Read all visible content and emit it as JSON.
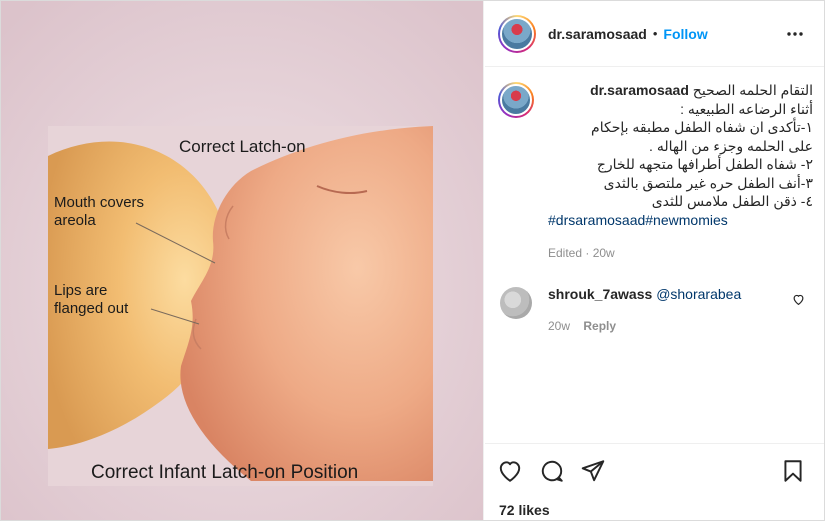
{
  "post": {
    "username": "dr.saramosaad",
    "separator": "•",
    "follow_label": "Follow",
    "more_icon": "more-horizontal-icon"
  },
  "image": {
    "title_top": "Correct Latch-on",
    "label_mouth": "Mouth covers areola",
    "label_lips": "Lips are flanged out",
    "title_bottom": "Correct Infant Latch-on Position",
    "colors": {
      "background": "#e8d7dc",
      "breast": "#f2c07a",
      "face": "#f1b38e"
    }
  },
  "caption": {
    "username": "dr.saramosaad",
    "lines": [
      "التقام الحلمه الصحيح",
      "أثناء الرضاعه الطبيعيه :",
      "١-تأكدى ان شفاه الطفل مطبقه بإحكام",
      "على الحلمه وجزء من الهاله .",
      "٢- شفاه الطفل أطرافها متجهه للخارج",
      "٣-أنف الطفل حره غير ملتصق بالثدى",
      "٤- ذقن الطفل ملامس للثدى"
    ],
    "hashtags": "#drsaramosaad#newmomies",
    "edited": "Edited · 20w"
  },
  "comments": [
    {
      "username": "shrouk_7awass",
      "mention": "@shorarabea",
      "time": "20w",
      "reply_label": "Reply",
      "like_icon": "heart-outline-icon"
    }
  ],
  "actions": {
    "like_icon": "heart-icon",
    "comment_icon": "comment-icon",
    "share_icon": "paper-plane-icon",
    "save_icon": "bookmark-icon",
    "likes": "72 likes"
  },
  "colors": {
    "accent": "#0095f6",
    "link": "#00376b",
    "muted": "#8e8e8e"
  }
}
